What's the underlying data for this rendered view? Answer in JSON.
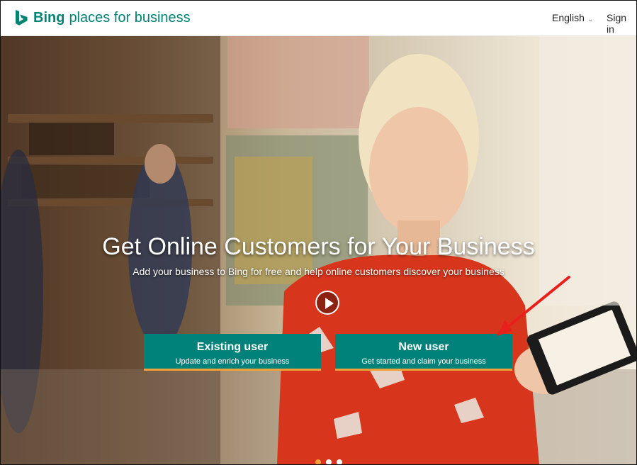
{
  "header": {
    "brand": "Bing",
    "brand_suffix": "places for business",
    "language": "English",
    "signin": "Sign in"
  },
  "hero": {
    "headline": "Get Online Customers for Your Business",
    "subline": "Add your business to Bing for free and help online customers discover your business",
    "existing_user": {
      "title": "Existing user",
      "subtitle": "Update and enrich your business"
    },
    "new_user": {
      "title": "New user",
      "subtitle": "Get started and claim your business"
    }
  },
  "carousel": {
    "slides": 3,
    "active": 1
  },
  "colors": {
    "brand": "#008373",
    "button": "#00827a",
    "button_accent": "#f0a23a",
    "arrow": "#e8201c"
  },
  "icons": [
    "bing-logo-icon",
    "chevron-down-icon",
    "play-icon"
  ]
}
